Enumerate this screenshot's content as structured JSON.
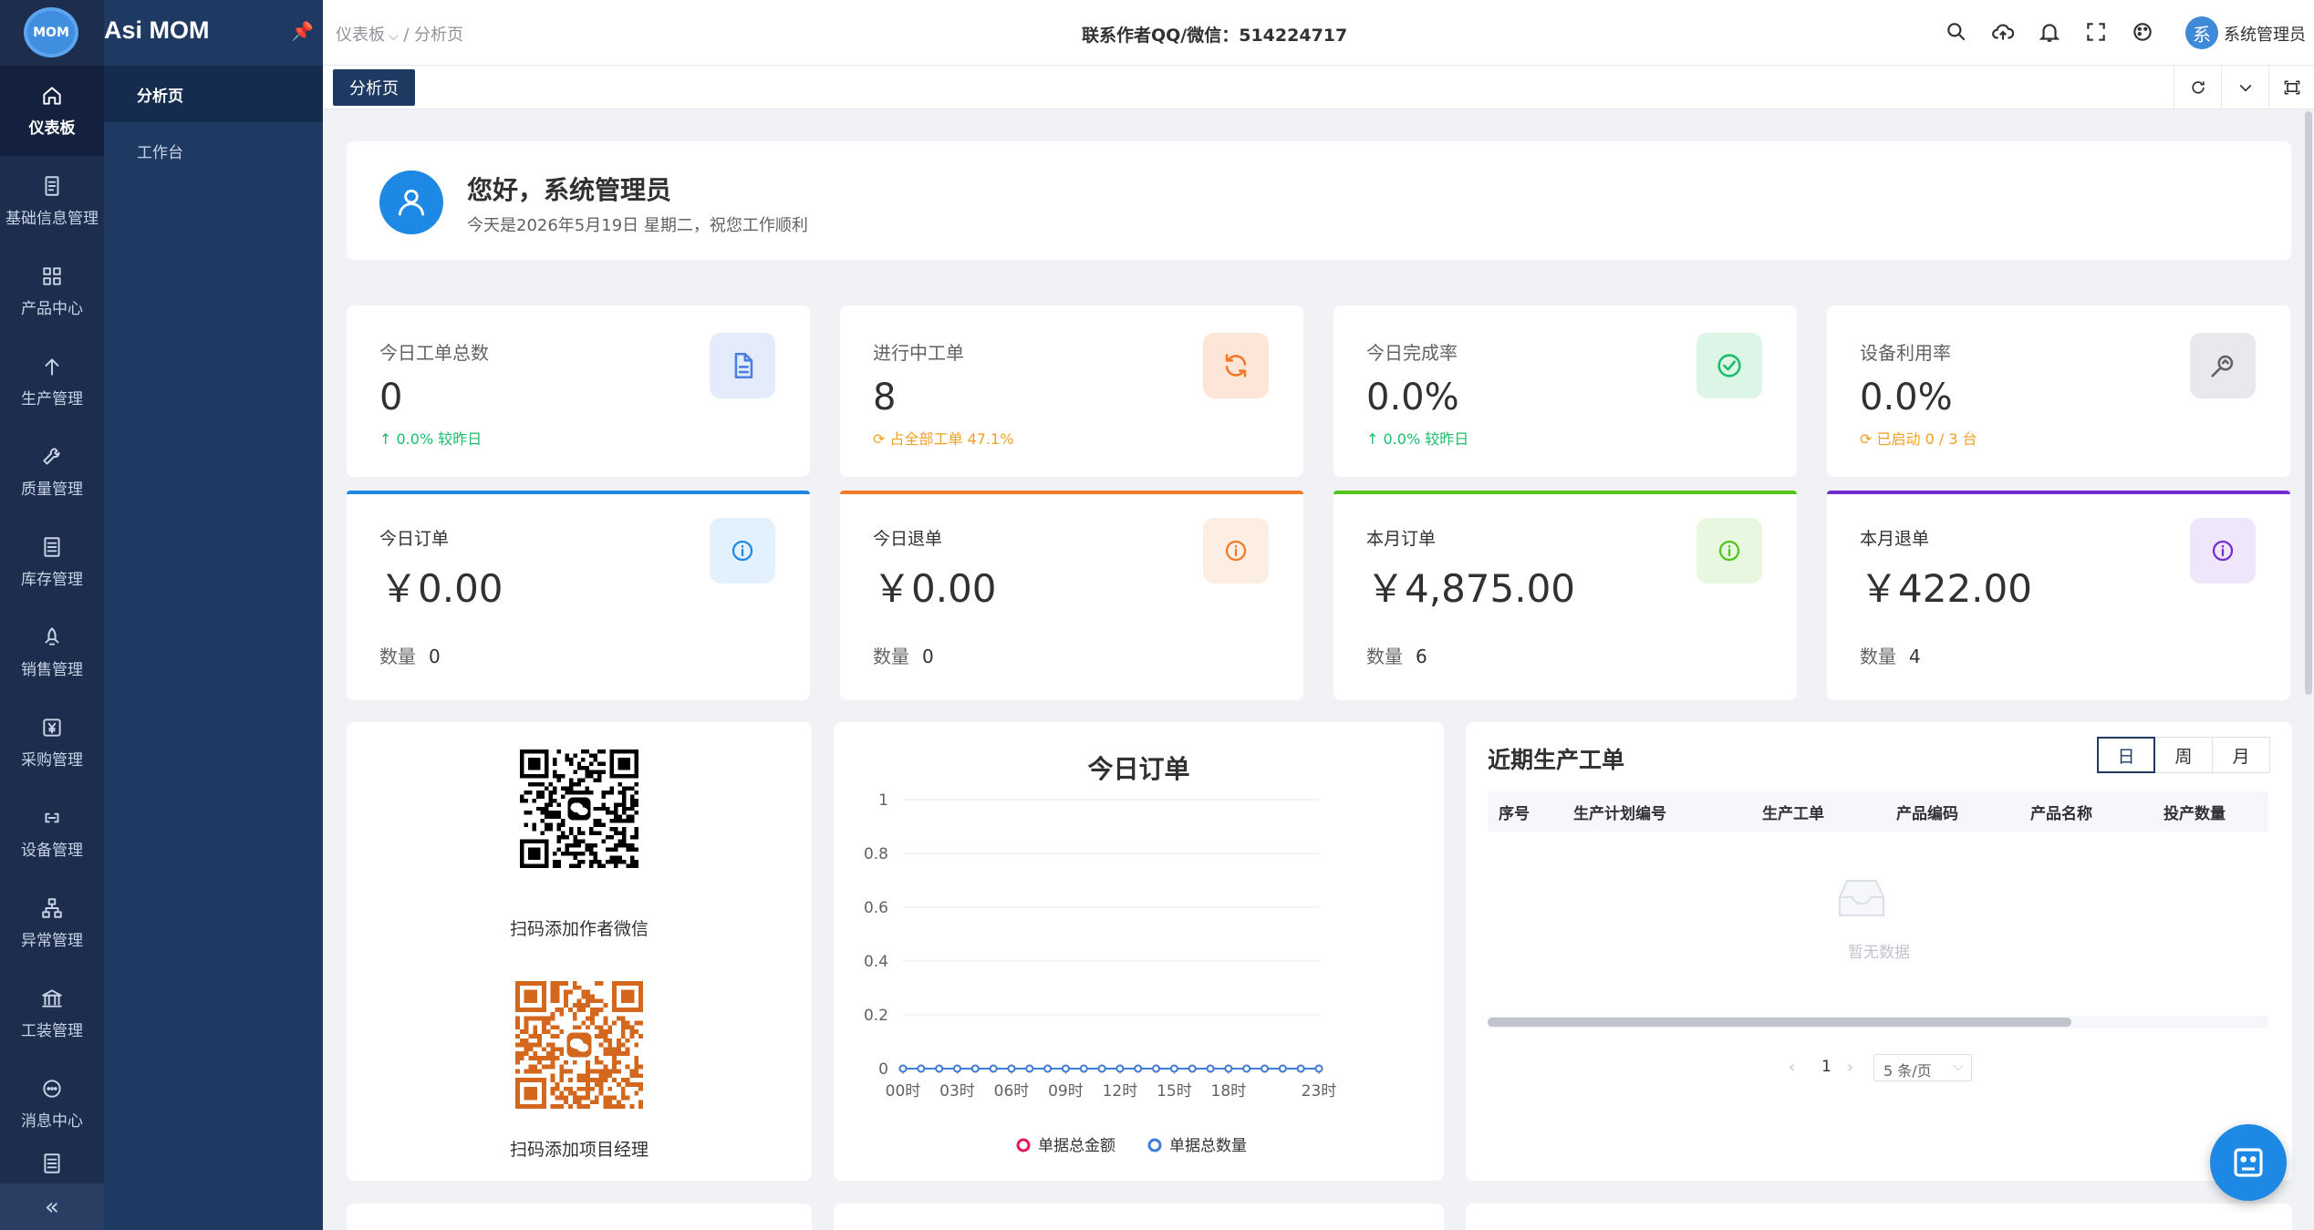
{
  "app": {
    "logo_text": "MOM",
    "title": "Asi MOM"
  },
  "rail": [
    {
      "label": "仪表板",
      "icon": "home-icon",
      "active": true
    },
    {
      "label": "基础信息管理",
      "icon": "document-icon"
    },
    {
      "label": "产品中心",
      "icon": "grid-icon"
    },
    {
      "label": "生产管理",
      "icon": "arrow-up-icon"
    },
    {
      "label": "质量管理",
      "icon": "wrench-icon"
    },
    {
      "label": "库存管理",
      "icon": "list-icon"
    },
    {
      "label": "销售管理",
      "icon": "rocket-icon"
    },
    {
      "label": "采购管理",
      "icon": "yen-icon"
    },
    {
      "label": "设备管理",
      "icon": "link-icon"
    },
    {
      "label": "异常管理",
      "icon": "sitemap-icon"
    },
    {
      "label": "工装管理",
      "icon": "bank-icon"
    },
    {
      "label": "消息中心",
      "icon": "chat-icon"
    }
  ],
  "rail_collapse": "«",
  "submenu": [
    {
      "label": "分析页",
      "active": true
    },
    {
      "label": "工作台"
    }
  ],
  "header": {
    "breadcrumb_root": "仪表板",
    "breadcrumb_sep": " / ",
    "breadcrumb_leaf": "分析页",
    "contact": "联系作者QQ/微信：514224717",
    "avatar_text": "系",
    "user_name": "系统管理员"
  },
  "tabs": {
    "active": "分析页"
  },
  "welcome": {
    "title": "您好，系统管理员",
    "subtitle": "今天是2026年5月19日 星期二，祝您工作顺利"
  },
  "stats": [
    {
      "label": "今日工单总数",
      "value": "0",
      "note": "↑ 0.0% 较昨日",
      "note_color": "#19be6b",
      "icon": "file-icon",
      "icon_bg": "#e4ebfb",
      "icon_color": "#4a7ee0"
    },
    {
      "label": "进行中工单",
      "value": "8",
      "note": "⟳ 占全部工单 47.1%",
      "note_color": "#f0a020",
      "icon": "refresh-icon",
      "icon_bg": "#fde6d8",
      "icon_color": "#f07828"
    },
    {
      "label": "今日完成率",
      "value": "0.0%",
      "note": "↑ 0.0% 较昨日",
      "note_color": "#19be6b",
      "icon": "check-circle-icon",
      "icon_bg": "#dcf5e7",
      "icon_color": "#19be6b"
    },
    {
      "label": "设备利用率",
      "value": "0.0%",
      "note": "⟳ 已启动 0 / 3 台",
      "note_color": "#f0a020",
      "icon": "gauge-icon",
      "icon_bg": "#e8e9ec",
      "icon_color": "#606266"
    }
  ],
  "orders": [
    {
      "label": "今日订单",
      "value": "￥0.00",
      "count_label": "数量",
      "count": "0",
      "accent": "#1e88e5",
      "icon_bg": "#e3f1fd",
      "icon_color": "#1e88e5"
    },
    {
      "label": "今日退单",
      "value": "￥0.00",
      "count_label": "数量",
      "count": "0",
      "accent": "#f07828",
      "icon_bg": "#fdeee3",
      "icon_color": "#f07828"
    },
    {
      "label": "本月订单",
      "value": "￥4,875.00",
      "count_label": "数量",
      "count": "6",
      "accent": "#52c41a",
      "icon_bg": "#e7f7e0",
      "icon_color": "#52c41a"
    },
    {
      "label": "本月退单",
      "value": "￥422.00",
      "count_label": "数量",
      "count": "4",
      "accent": "#722ed1",
      "icon_bg": "#efe6fb",
      "icon_color": "#722ed1"
    }
  ],
  "qr": {
    "wechat_caption": "扫码添加作者微信",
    "manager_caption": "扫码添加项目经理"
  },
  "chart_data": {
    "type": "line",
    "title": "今日订单",
    "x": [
      "00时",
      "01时",
      "02时",
      "03时",
      "04时",
      "05时",
      "06时",
      "07时",
      "08时",
      "09时",
      "10时",
      "11时",
      "12时",
      "13时",
      "14时",
      "15时",
      "16时",
      "17时",
      "18时",
      "19时",
      "20时",
      "21时",
      "22时",
      "23时"
    ],
    "x_tick_labels": [
      "00时",
      "03时",
      "06时",
      "09时",
      "12时",
      "15时",
      "18时",
      "23时"
    ],
    "y_ticks": [
      "0",
      "0.2",
      "0.4",
      "0.6",
      "0.8",
      "1"
    ],
    "ylim": [
      0,
      1
    ],
    "series": [
      {
        "name": "单据总金额",
        "color": "#e8185e",
        "values": [
          0,
          0,
          0,
          0,
          0,
          0,
          0,
          0,
          0,
          0,
          0,
          0,
          0,
          0,
          0,
          0,
          0,
          0,
          0,
          0,
          0,
          0,
          0,
          0
        ]
      },
      {
        "name": "单据总数量",
        "color": "#3f7fd9",
        "values": [
          0,
          0,
          0,
          0,
          0,
          0,
          0,
          0,
          0,
          0,
          0,
          0,
          0,
          0,
          0,
          0,
          0,
          0,
          0,
          0,
          0,
          0,
          0,
          0
        ]
      }
    ],
    "legend_position": "bottom",
    "grid": true
  },
  "table": {
    "title": "近期生产工单",
    "periods": [
      "日",
      "周",
      "月"
    ],
    "active_period": "日",
    "columns": [
      "序号",
      "生产计划编号",
      "生产工单",
      "产品编码",
      "产品名称",
      "投产数量"
    ],
    "empty_text": "暂无数据",
    "pager": {
      "prev": "‹",
      "page": "1",
      "next": "›",
      "size": "5 条/页"
    }
  }
}
